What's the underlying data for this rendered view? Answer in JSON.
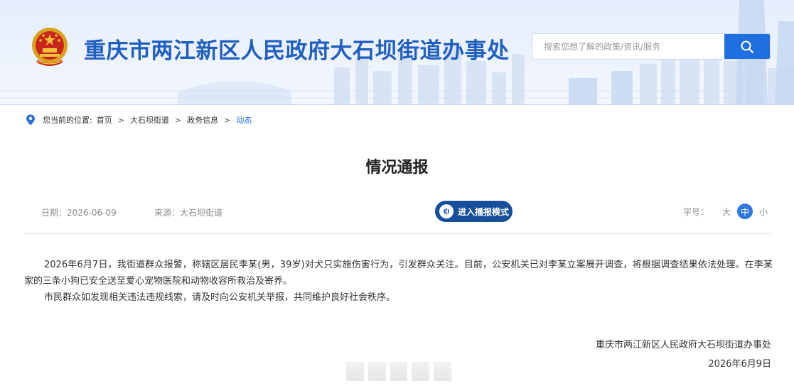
{
  "header": {
    "site_title": "重庆市两江新区人民政府大石坝街道办事处",
    "search_placeholder": "搜索您想了解的政策/资讯/服务"
  },
  "breadcrumb": {
    "prefix": "您当前的位置:",
    "items": [
      "首页",
      "大石坝街道",
      "政务信息",
      "动态"
    ],
    "separator": ">"
  },
  "article": {
    "title": "情况通报",
    "date": "日期：2026-06-09",
    "source": "来源：大石坝街道",
    "broadcast_label": "进入播报模式",
    "font_size": {
      "label": "字号：",
      "options": [
        "大",
        "中",
        "小"
      ],
      "selected": "中"
    },
    "paragraphs": [
      "2026年6月7日，我街道群众报警，称辖区居民李某(男，39岁)对犬只实施伤害行为，引发群众关注。目前，公安机关已对李某立案展开调查，将根据调查结果依法处理。在李某家的三条小狗已安全送至爱心宠物医院和动物收容所救治及寄养。",
      "市民群众如发现相关违法违规线索，请及时向公安机关举报，共同维护良好社会秩序。"
    ],
    "signature_org": "重庆市两江新区人民政府大石坝街道办事处",
    "signature_date": "2026年6月9日"
  },
  "colors": {
    "brand_blue": "#1f5fbf",
    "button_blue": "#1f6fe0",
    "broadcast_navy": "#164f9c"
  }
}
